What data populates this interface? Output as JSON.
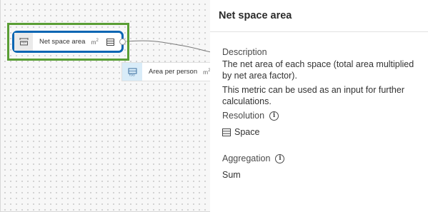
{
  "canvas": {
    "nodes": [
      {
        "label": "Net space area",
        "unit": "m",
        "unit_sup": "2",
        "icon": "area-measure-icon",
        "table_icon": "table-icon",
        "selected": true
      },
      {
        "label": "Area per person",
        "unit": "m",
        "unit_sup": "2",
        "icon": "formula-icon",
        "selected": false
      }
    ]
  },
  "panel": {
    "title": "Net space area",
    "description_label": "Description",
    "description_text": "The net area of each space (total area multiplied by net area factor).",
    "description_extra": "This metric can be used as an input for further calculations.",
    "resolution_label": "Resolution",
    "resolution_value": "Space",
    "resolution_icon": "table-icon",
    "aggregation_label": "Aggregation",
    "aggregation_value": "Sum",
    "info_icon": "info-icon"
  },
  "colors": {
    "selected_border": "#0a66b3",
    "highlight_border": "#5a9e35",
    "node_icon_bg_blue": "#d9ecf8"
  }
}
